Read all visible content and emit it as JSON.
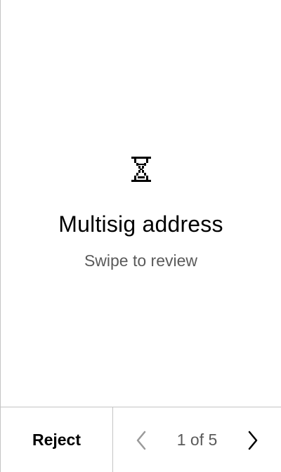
{
  "main": {
    "icon": "hourglass-icon",
    "title": "Multisig address",
    "subtitle": "Swipe to review"
  },
  "footer": {
    "reject_label": "Reject",
    "page_indicator": "1 of 5",
    "prev_icon": "chevron-left-icon",
    "next_icon": "chevron-right-icon"
  },
  "colors": {
    "border": "#c4c4c4",
    "text": "#000000",
    "secondary_text": "#5a5a5a",
    "disabled": "#9a9a9a"
  }
}
